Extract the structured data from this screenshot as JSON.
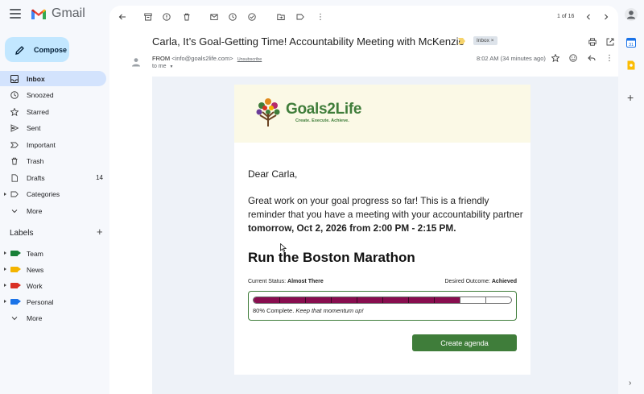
{
  "app": {
    "name": "Gmail"
  },
  "compose": {
    "label": "Compose"
  },
  "nav": [
    {
      "label": "Inbox",
      "icon": "inbox-icon",
      "active": true,
      "count": ""
    },
    {
      "label": "Snoozed",
      "icon": "clock-icon",
      "count": ""
    },
    {
      "label": "Starred",
      "icon": "star-icon",
      "count": ""
    },
    {
      "label": "Sent",
      "icon": "send-icon",
      "count": ""
    },
    {
      "label": "Important",
      "icon": "important-icon",
      "count": ""
    },
    {
      "label": "Trash",
      "icon": "trash-icon",
      "count": ""
    },
    {
      "label": "Drafts",
      "icon": "draft-icon",
      "count": "14"
    },
    {
      "label": "Categories",
      "icon": "label-icon",
      "count": ""
    },
    {
      "label": "More",
      "icon": "chevron-down-icon",
      "count": ""
    }
  ],
  "labels": {
    "header": "Labels",
    "items": [
      {
        "label": "Team",
        "color": "#188038"
      },
      {
        "label": "News",
        "color": "#f4b400"
      },
      {
        "label": "Work",
        "color": "#d93025"
      },
      {
        "label": "Personal",
        "color": "#1a73e8"
      }
    ],
    "more": "More"
  },
  "toolbar": {
    "pager": "1 of 16"
  },
  "message": {
    "subject": "Carla, It’s Goal-Getting Time! Accountability Meeting with McKenzie",
    "chip": "Inbox",
    "chip_close": "×",
    "from_label": "FROM",
    "from_email": "<info@goals2life.com>",
    "unsubscribe": "Unsubscribe",
    "to": "to me",
    "date": "8:02 AM (34 minutes ago)"
  },
  "email": {
    "brand_name": "Goals2Life",
    "brand_tagline": "Create. Execute. Achieve.",
    "greeting": "Dear Carla,",
    "body_text": "Great work on your goal progress so far! This is a friendly reminder that you have a meeting with your accountability partner ",
    "body_bold": "tomorrow, Oct 2, 2026 from 2:00 PM - 2:15 PM.",
    "goal_title": "Run the Boston Marathon",
    "status_label": "Current Status:",
    "status_value": "Almost There",
    "outcome_label": "Desired Outcome:",
    "outcome_value": "Achieved",
    "progress_percent": 80,
    "progress_label": "80% Complete.",
    "progress_note": "Keep that momentum up!",
    "cta_label": "Create agenda"
  },
  "colors": {
    "accent": "#c2e7ff",
    "active_nav": "#d3e3fd",
    "brand_green": "#3f7d3a",
    "progress_fill": "#880e4f"
  }
}
